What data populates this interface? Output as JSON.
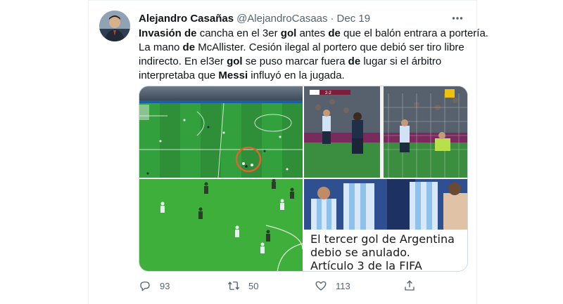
{
  "tweet": {
    "author": {
      "display_name": "Alejandro Casañas",
      "handle": "@AlejandroCasaas",
      "date": "Dec 19",
      "separator": "·"
    },
    "text_lines": [
      [
        {
          "t": "Invasión de",
          "b": true
        },
        {
          "t": " cancha en el 3er ",
          "b": false
        },
        {
          "t": "gol",
          "b": true
        },
        {
          "t": " antes ",
          "b": false
        },
        {
          "t": "de",
          "b": true
        },
        {
          "t": " que el balón  entrara a portería.",
          "b": false
        }
      ],
      [
        {
          "t": "La mano ",
          "b": false
        },
        {
          "t": "de",
          "b": true
        },
        {
          "t": " McAllister.  Cesión ilegal al portero que debió ser tiro libre",
          "b": false
        }
      ],
      [
        {
          "t": "indirecto. En el3er ",
          "b": false
        },
        {
          "t": "gol",
          "b": true
        },
        {
          "t": " se puso marcar fuera ",
          "b": false
        },
        {
          "t": "de",
          "b": true
        },
        {
          "t": " lugar si el árbitro",
          "b": false
        }
      ],
      [
        {
          "t": "interpretaba que ",
          "b": false
        },
        {
          "t": "Messi",
          "b": true
        },
        {
          "t": " influyó en la jugada.",
          "b": false
        }
      ]
    ],
    "media": {
      "scoreboard": "2-2",
      "caption_lines": [
        "El tercer gol de Argentina",
        "debio se anulado.",
        "Artículo 3 de la FIFA"
      ]
    },
    "stats": {
      "replies": "93",
      "retweets": "50",
      "likes": "113"
    },
    "icons": [
      "more-icon",
      "reply-icon",
      "retweet-icon",
      "like-icon",
      "share-icon"
    ],
    "colors": {
      "text": "#0f1419",
      "secondary": "#536471",
      "border": "#cfd9de",
      "pitch": "#2f9a3a"
    }
  }
}
